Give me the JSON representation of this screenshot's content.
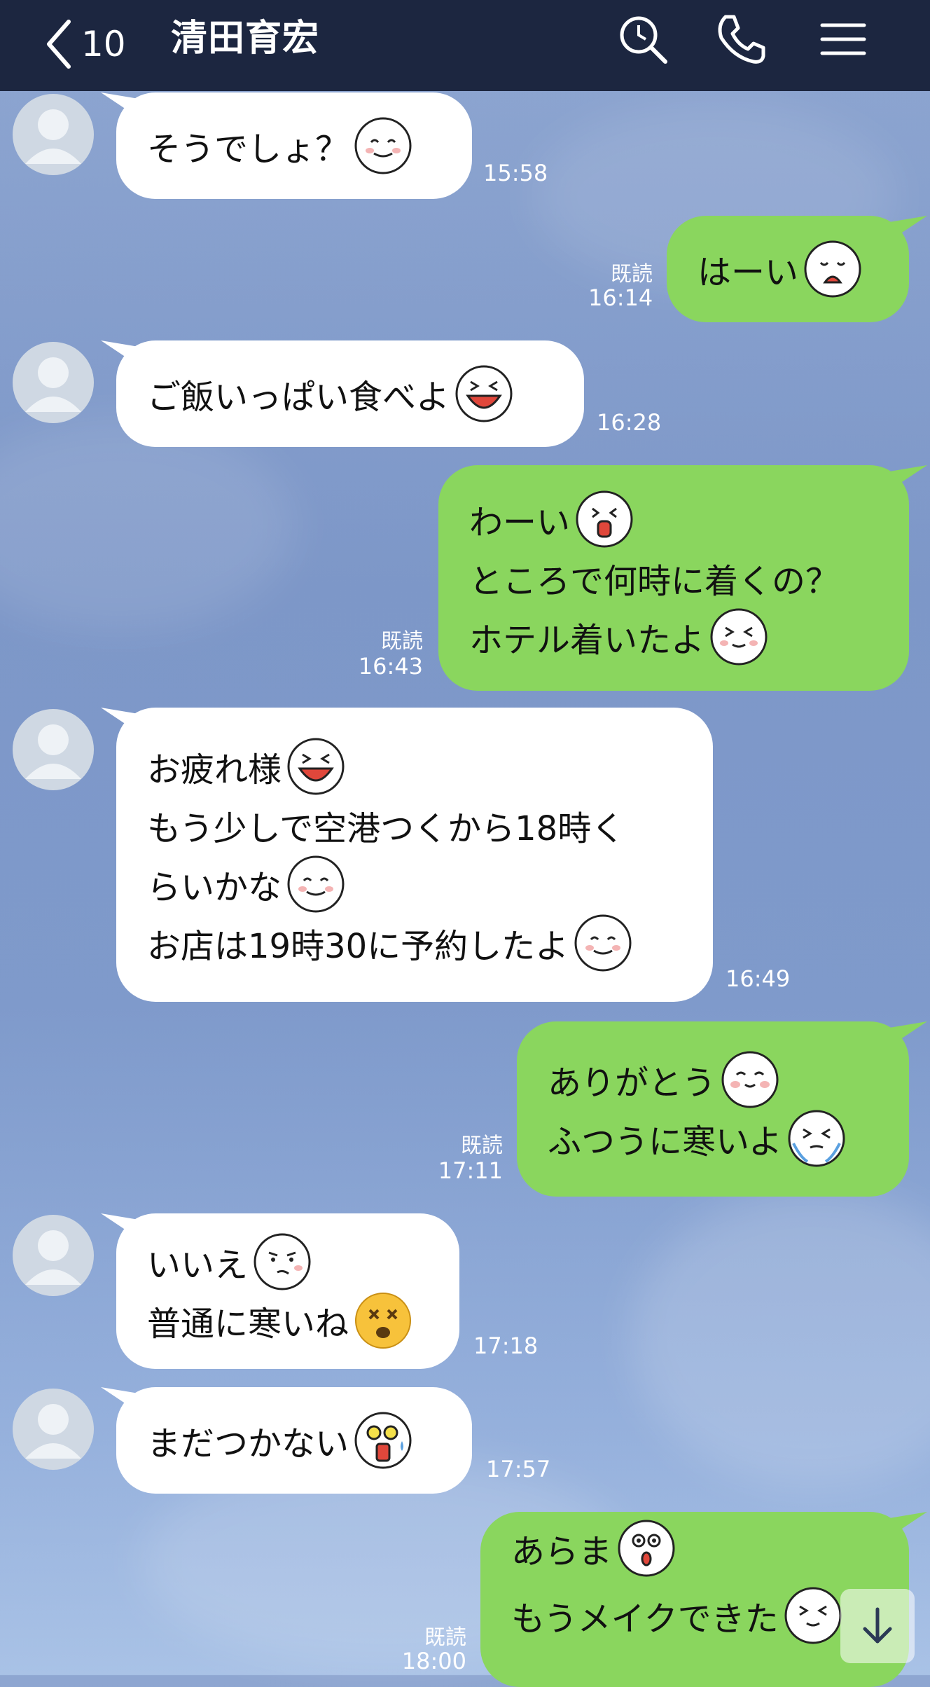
{
  "header": {
    "unread_count": "10",
    "title": "清田育宏"
  },
  "messages": [
    {
      "side": "in",
      "lines": [
        "そうでしょ？"
      ],
      "time": "15:58"
    },
    {
      "side": "out",
      "lines": [
        "はーい"
      ],
      "time": "16:14",
      "read": "既読"
    },
    {
      "side": "in",
      "lines": [
        "ご飯いっぱい食べよ"
      ],
      "time": "16:28"
    },
    {
      "side": "out",
      "lines": [
        "わーい",
        "ところで何時に着くの？",
        "ホテル着いたよ"
      ],
      "time": "16:43",
      "read": "既読"
    },
    {
      "side": "in",
      "lines": [
        "お疲れ様",
        "もう少しで空港つくから18時く",
        "らいかな",
        "お店は19時30に予約したよ"
      ],
      "time": "16:49"
    },
    {
      "side": "out",
      "lines": [
        "ありがとう",
        "ふつうに寒いよ"
      ],
      "time": "17:11",
      "read": "既読"
    },
    {
      "side": "in",
      "lines": [
        "いいえ",
        "普通に寒いね"
      ],
      "time": "17:18"
    },
    {
      "side": "in",
      "lines": [
        "まだつかない"
      ],
      "time": "17:57"
    },
    {
      "side": "out",
      "lines": [
        "あらま",
        "もうメイクできた"
      ],
      "time": "18:00",
      "read": "既読"
    }
  ],
  "icons": {
    "back": "chevron-left-icon",
    "search": "search-icon",
    "call": "phone-icon",
    "menu": "menu-icon",
    "scroll": "arrow-down-icon",
    "avatar": "avatar-placeholder-icon"
  },
  "colors": {
    "header": "#1c2640",
    "incoming": "#ffffff",
    "outgoing": "#8ad65e"
  }
}
